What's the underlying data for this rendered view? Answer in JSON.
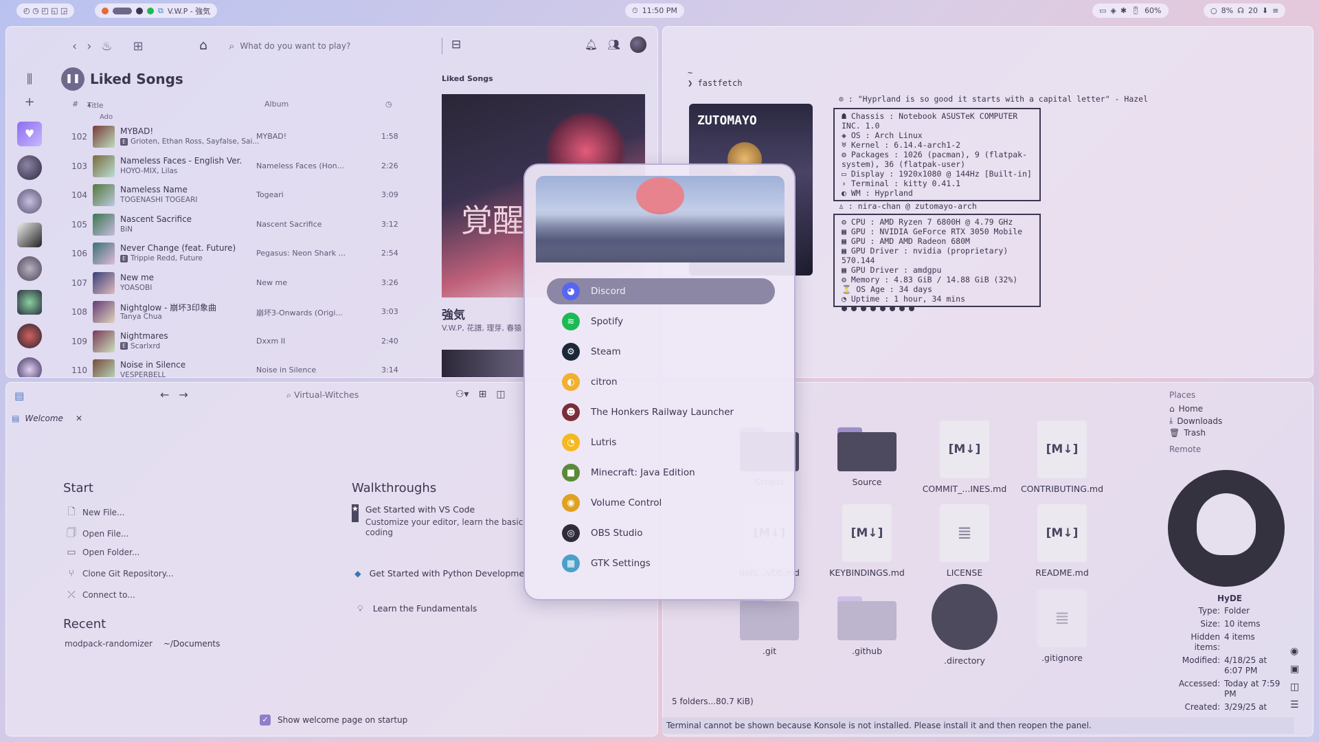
{
  "topbar": {
    "workspaces": "◴ ◷ ◰ ◱ ◲",
    "active_window": "V.W.P - 強気",
    "clock": "11:50 PM",
    "battery": "60%",
    "cpu": "8%",
    "mem": "20"
  },
  "spotify": {
    "search_placeholder": "What do you want to play?",
    "playlist_title": "Liked Songs",
    "header": {
      "num": "#",
      "title": "Title",
      "album": "Album"
    },
    "partial_track": "Ado",
    "tracks": [
      {
        "num": "102",
        "title": "MYBAD!",
        "artist": "Grioten, Ethan Ross, Sayfalse, Sai...",
        "explicit": true,
        "album": "MYBAD!",
        "duration": "1:58"
      },
      {
        "num": "103",
        "title": "Nameless Faces - English Ver.",
        "artist": "HOYO-MIX, Lilas",
        "explicit": false,
        "album": "Nameless Faces (Hon...",
        "duration": "2:26"
      },
      {
        "num": "104",
        "title": "Nameless Name",
        "artist": "TOGENASHI TOGEARI",
        "explicit": false,
        "album": "Togeari",
        "duration": "3:09"
      },
      {
        "num": "105",
        "title": "Nascent Sacrifice",
        "artist": "BiN",
        "explicit": false,
        "album": "Nascent Sacrifice",
        "duration": "3:12"
      },
      {
        "num": "106",
        "title": "Never Change (feat. Future)",
        "artist": "Trippie Redd, Future",
        "explicit": true,
        "album": "Pegasus: Neon Shark ...",
        "duration": "2:54"
      },
      {
        "num": "107",
        "title": "New me",
        "artist": "YOASOBI",
        "explicit": false,
        "album": "New me",
        "duration": "3:26"
      },
      {
        "num": "108",
        "title": "Nightglow - 崩坏3印象曲",
        "artist": "Tanya Chua",
        "explicit": false,
        "album": "崩坏3-Onwards (Origi...",
        "duration": "3:03"
      },
      {
        "num": "109",
        "title": "Nightmares",
        "artist": "Scarlxrd",
        "explicit": true,
        "album": "Dxxm II",
        "duration": "2:40"
      },
      {
        "num": "110",
        "title": "Noise in Silence",
        "artist": "VESPERBELL",
        "explicit": false,
        "album": "Noise in Silence",
        "duration": "3:14"
      }
    ],
    "now_playing_label": "Liked Songs",
    "cover_text": "覚醒",
    "now_playing_song": "強気",
    "now_playing_artist": "V.W.P, 花譜, 理芽, 春猿"
  },
  "terminal": {
    "tilde": "~",
    "prompt": "❯ fastfetch",
    "logo_text": "ZUTOMAYO",
    "quote": "⊙ : \"Hyprland is so good it starts with a capital letter\" - Hazel",
    "sys": [
      "☗ Chassis : Notebook ASUSTeK COMPUTER INC. 1.0",
      "◈ OS : Arch Linux",
      "♅ Kernel : 6.14.4-arch1-2",
      "⚙ Packages : 1026 (pacman), 9 (flatpak-system), 36 (flatpak-user)",
      "▭ Display : 1920x1080 @ 144Hz [Built-in]",
      "› Terminal : kitty 0.41.1",
      "◐ WM : Hyprland"
    ],
    "user": "♙ : nira-chan @ zutomayo-arch",
    "hw": [
      "⚙ CPU : AMD Ryzen 7 6800H @ 4.79 GHz",
      "▦ GPU : NVIDIA GeForce RTX 3050 Mobile",
      "▦ GPU : AMD AMD Radeon 680M",
      "▦ GPU Driver : nvidia (proprietary) 570.144",
      "▦ GPU Driver : amdgpu",
      "⚙ Memory : 4.83 GiB / 14.88 GiB (32%)",
      "⏳ OS Age : 34 days",
      "◔ Uptime : 1 hour, 34 mins"
    ]
  },
  "vscode": {
    "search": "Virtual-Witches",
    "tab": "Welcome",
    "start_title": "Start",
    "start_links": [
      "New File...",
      "Open File...",
      "Open Folder...",
      "Clone Git Repository...",
      "Connect to..."
    ],
    "recent_title": "Recent",
    "recent_name": "modpack-randomizer",
    "recent_path": "~/Documents",
    "walk_title": "Walkthroughs",
    "walk1_title": "Get Started with VS Code",
    "walk1_sub1": "Customize your editor, learn the basics, and start",
    "walk1_sub2": "coding",
    "walk2_title": "Get Started with Python Development",
    "walk3_title": "Learn the Fundamentals",
    "show_welcome": "Show welcome page on startup"
  },
  "dolphin": {
    "row1": [
      "Scripts",
      "Source",
      "COMMIT_...INES.md",
      "CONTRIBUTING.md"
    ],
    "row2": [
      "dots...yDE.md",
      "KEYBINDINGS.md",
      "LICENSE",
      "README.md"
    ],
    "row3": [
      ".git",
      ".github",
      ".directory",
      ".gitignore"
    ],
    "places_title": "Places",
    "places": [
      "Home",
      "Downloads",
      "Trash"
    ],
    "remote": "Remote",
    "props": {
      "name": "HyDE",
      "type_k": "Type:",
      "type_v": "Folder",
      "size_k": "Size:",
      "size_v": "10 items",
      "hidden_k": "Hidden items:",
      "hidden_v": "4 items",
      "mod_k": "Modified:",
      "mod_v": "4/18/25 at 6:07 PM",
      "acc_k": "Accessed:",
      "acc_v": "Today at 7:59 PM",
      "cre_k": "Created:",
      "cre_v": "3/29/25 at"
    },
    "status": "5 folders...80.7 KiB)",
    "warning": "Terminal cannot be shown because Konsole is not installed. Please install it and then reopen the panel."
  },
  "launcher": {
    "apps": [
      {
        "name": "Discord",
        "icon": "discord-icon",
        "color": "#5865f2"
      },
      {
        "name": "Spotify",
        "icon": "spotify-icon",
        "color": "#1db954"
      },
      {
        "name": "Steam",
        "icon": "steam-icon",
        "color": "#1b2838"
      },
      {
        "name": "citron",
        "icon": "citron-icon",
        "color": "#f0b030"
      },
      {
        "name": "The Honkers Railway Launcher",
        "icon": "honkers-icon",
        "color": "#7a2e3a"
      },
      {
        "name": "Lutris",
        "icon": "lutris-icon",
        "color": "#f5b820"
      },
      {
        "name": "Minecraft: Java Edition",
        "icon": "minecraft-icon",
        "color": "#5a8a3a"
      },
      {
        "name": "Volume Control",
        "icon": "volume-icon",
        "color": "#e0a020"
      },
      {
        "name": "OBS Studio",
        "icon": "obs-icon",
        "color": "#2e2c38"
      },
      {
        "name": "GTK Settings",
        "icon": "gtk-settings-icon",
        "color": "#4aa0c8"
      }
    ]
  }
}
